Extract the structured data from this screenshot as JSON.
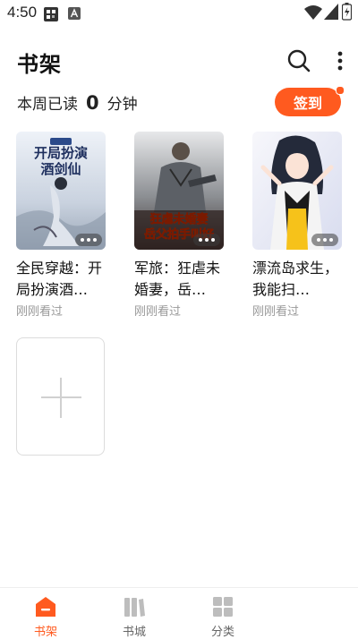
{
  "status_bar": {
    "time": "4:50"
  },
  "header": {
    "title": "书架"
  },
  "reading": {
    "prefix": "本周已读",
    "minutes": "0",
    "unit": "分钟"
  },
  "checkin": {
    "label": "签到"
  },
  "books": [
    {
      "title": "全民穿越：开局扮演酒…",
      "status": "刚刚看过",
      "cover_text": "开局扮演酒剑仙"
    },
    {
      "title": "军旅：狂虐未婚妻，岳…",
      "status": "刚刚看过",
      "cover_text": "狂虐未婚妻 岳父拍手叫好"
    },
    {
      "title": "漂流岛求生，我能扫…",
      "status": "刚刚看过"
    }
  ],
  "bottom_nav": [
    {
      "label": "书架",
      "icon": "bookshelf-icon",
      "active": true
    },
    {
      "label": "书城",
      "icon": "bookstore-icon",
      "active": false
    },
    {
      "label": "分类",
      "icon": "category-grid-icon",
      "active": false
    }
  ],
  "colors": {
    "accent": "#ff5a1f",
    "muted_text": "#999999"
  }
}
